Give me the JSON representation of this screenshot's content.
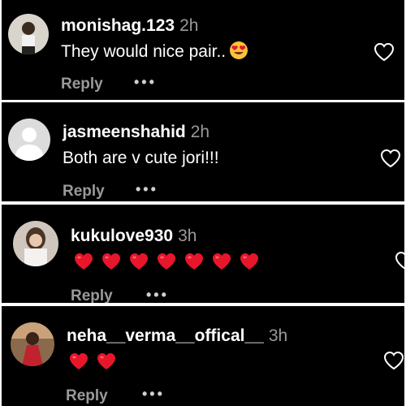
{
  "comments": [
    {
      "username": "monishag.123",
      "time": "2h",
      "text": "They would nice pair..",
      "emoji": "heart-eyes-emoji",
      "reply_label": "Reply",
      "more_label": "•••"
    },
    {
      "username": "jasmeenshahid",
      "time": "2h",
      "text": "Both are v cute jori!!!",
      "reply_label": "Reply",
      "more_label": "•••"
    },
    {
      "username": "kukulove930",
      "time": "3h",
      "hearts_count": 7,
      "reply_label": "Reply",
      "more_label": "•••"
    },
    {
      "username": "neha__verma__offical__",
      "time": "3h",
      "hearts_count": 2,
      "reply_label": "Reply",
      "more_label": "•••"
    }
  ],
  "colors": {
    "background": "#000000",
    "secondary_text": "#9a9a9a",
    "heart_red": "#e8162b"
  }
}
